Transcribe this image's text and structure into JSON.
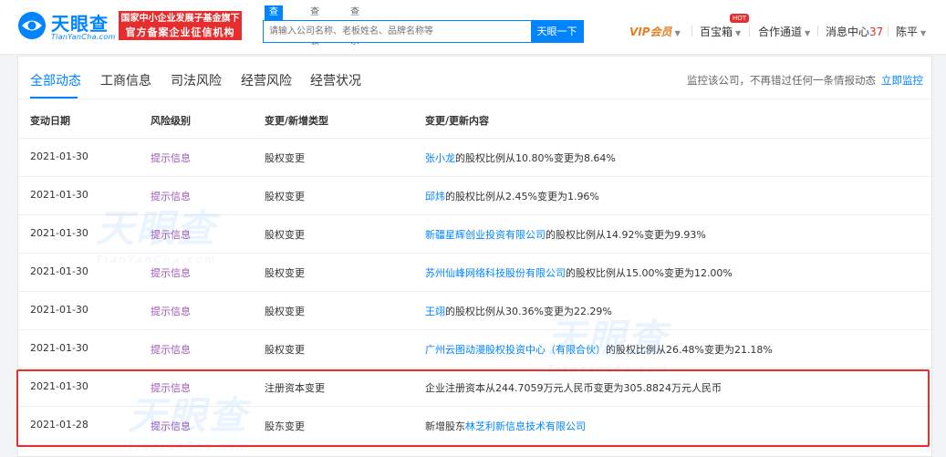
{
  "header": {
    "logo_text": "天眼查",
    "logo_sub": "TianYanCha.com",
    "slogan_line1": "国家中小企业发展子基金旗下",
    "slogan_line2": "官方备案企业征信机构",
    "search_tabs": [
      "查公司",
      "查老板",
      "查关系"
    ],
    "search_placeholder": "请输入公司名称、老板姓名、品牌名称等",
    "search_button": "天眼一下",
    "vip_label": "VIP会员",
    "baibaoxiang": "百宝箱",
    "hot_badge": "HOT",
    "hezuo": "合作通道",
    "message_label": "消息中心",
    "message_count": "37",
    "user_name": "陈平"
  },
  "tabs": [
    "全部动态",
    "工商信息",
    "司法风险",
    "经营风险",
    "经营状况"
  ],
  "monitor": {
    "text": "监控该公司，不再错过任何一条情报动态",
    "link": "立即监控"
  },
  "table": {
    "headers": [
      "变动日期",
      "风险级别",
      "变更/新增类型",
      "变更/更新内容"
    ],
    "rows": [
      {
        "date": "2021-01-30",
        "risk": "提示信息",
        "type": "股权变更",
        "link": "张小龙",
        "rest": "的股权比例从10.80%变更为8.64%"
      },
      {
        "date": "2021-01-30",
        "risk": "提示信息",
        "type": "股权变更",
        "link": "邱炜",
        "rest": "的股权比例从2.45%变更为1.96%"
      },
      {
        "date": "2021-01-30",
        "risk": "提示信息",
        "type": "股权变更",
        "link": "新疆星辉创业投资有限公司",
        "rest": "的股权比例从14.92%变更为9.93%"
      },
      {
        "date": "2021-01-30",
        "risk": "提示信息",
        "type": "股权变更",
        "link": "苏州仙峰网络科技股份有限公司",
        "rest": "的股权比例从15.00%变更为12.00%"
      },
      {
        "date": "2021-01-30",
        "risk": "提示信息",
        "type": "股权变更",
        "link": "王翊",
        "rest": "的股权比例从30.36%变更为22.29%"
      },
      {
        "date": "2021-01-30",
        "risk": "提示信息",
        "type": "股权变更",
        "link": "广州云图动漫股权投资中心（有限合伙）",
        "rest": "的股权比例从26.48%变更为21.18%"
      },
      {
        "date": "2021-01-30",
        "risk": "提示信息",
        "type": "注册资本变更",
        "link": "",
        "rest": "企业注册资本从244.7059万元人民币变更为305.8824万元人民币"
      },
      {
        "date": "2021-01-28",
        "risk": "提示信息",
        "type": "股东变更",
        "prefix": "新增股东",
        "link": "林芝利新信息技术有限公司",
        "rest": ""
      }
    ]
  },
  "colors": {
    "brand": "#0084ff",
    "highlight_border": "#e62e2e",
    "risk": "#9b59b6"
  }
}
